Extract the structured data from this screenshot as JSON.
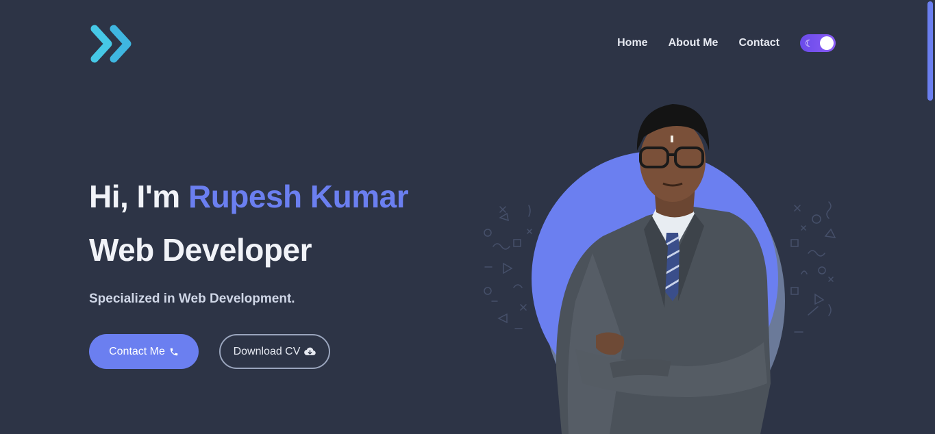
{
  "nav": {
    "items": [
      {
        "label": "Home"
      },
      {
        "label": "About Me"
      },
      {
        "label": "Contact"
      }
    ],
    "theme_toggle_icon": "moon-icon"
  },
  "hero": {
    "greeting": "Hi, I'm ",
    "name": "Rupesh Kumar",
    "role": "Web Developer",
    "tagline": "Specialized in Web Development.",
    "contact_button": "Contact Me",
    "contact_icon": "phone-icon",
    "download_button": "Download CV",
    "download_icon": "cloud-download-icon"
  },
  "colors": {
    "background": "#2d3446",
    "accent": "#6b7ff0",
    "logo": "#46c8e6",
    "text": "#f1f3f8"
  }
}
